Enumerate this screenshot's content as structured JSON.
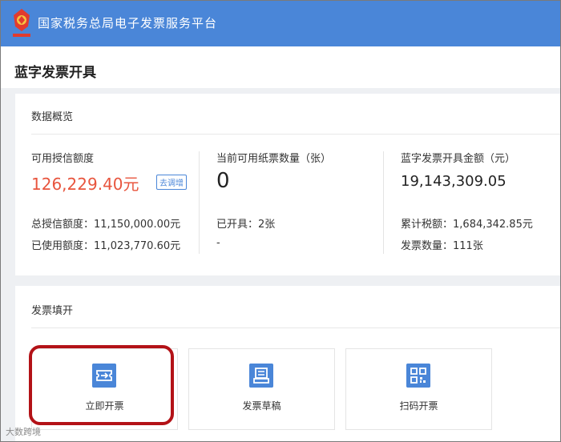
{
  "header": {
    "title": "国家税务总局电子发票服务平台",
    "logo_icon": "tax-emblem-icon",
    "color": "#4a86d8"
  },
  "page": {
    "title": "蓝字发票开具"
  },
  "overview": {
    "title": "数据概览",
    "credit": {
      "label": "可用授信额度",
      "value": "126,229.40元",
      "adjust_button": "去调增",
      "total_label": "总授信额度：",
      "total_value": "11,150,000.00元",
      "used_label": "已使用额度：",
      "used_value": "11,023,770.60元"
    },
    "paper": {
      "label": "当前可用纸票数量（张）",
      "value": "0",
      "issued_label": "已开具：",
      "issued_value": "2张",
      "extra": "-"
    },
    "amount": {
      "label": "蓝字发票开具金额（元）",
      "value": "19,143,309.05",
      "tax_label": "累计税额：",
      "tax_value": "1,684,342.85元",
      "count_label": "发票数量：",
      "count_value": "111张"
    }
  },
  "fill": {
    "title": "发票填开",
    "tiles": [
      {
        "label": "立即开票",
        "icon": "issue-invoice-icon"
      },
      {
        "label": "发票草稿",
        "icon": "invoice-draft-icon"
      },
      {
        "label": "扫码开票",
        "icon": "qr-code-icon"
      }
    ]
  },
  "watermark": "大数跨境",
  "colors": {
    "accent": "#4a86d8",
    "red_value": "#e8553e",
    "highlight": "#b31217"
  }
}
